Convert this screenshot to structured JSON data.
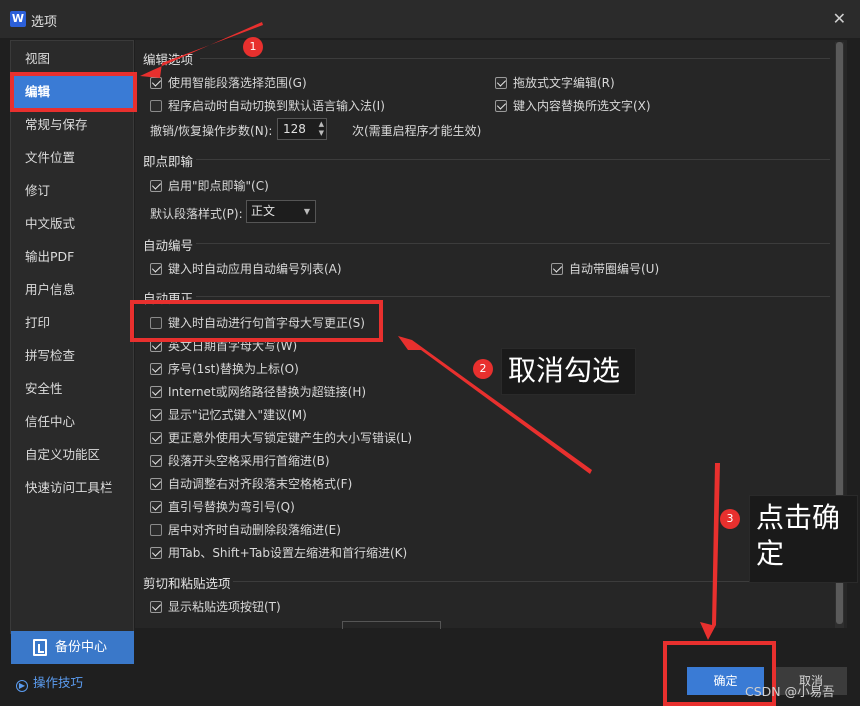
{
  "window": {
    "title": "选项",
    "logo_letter": "W"
  },
  "sidebar": {
    "items": [
      {
        "label": "视图"
      },
      {
        "label": "编辑"
      },
      {
        "label": "常规与保存"
      },
      {
        "label": "文件位置"
      },
      {
        "label": "修订"
      },
      {
        "label": "中文版式"
      },
      {
        "label": "输出PDF"
      },
      {
        "label": "用户信息"
      },
      {
        "label": "打印"
      },
      {
        "label": "拼写检查"
      },
      {
        "label": "安全性"
      },
      {
        "label": "信任中心"
      },
      {
        "label": "自定义功能区"
      },
      {
        "label": "快速访问工具栏"
      }
    ],
    "active_index": 1,
    "backup_label": "备份中心",
    "tips_label": "操作技巧"
  },
  "edit_options": {
    "title": "编辑选项",
    "smart_select": "使用智能段落选择范围(G)",
    "drag_edit": "拖放式文字编辑(R)",
    "auto_input_method": "程序启动时自动切换到默认语言输入法(I)",
    "replace_selection": "键入内容替换所选文字(X)",
    "undo_steps_label": "撤销/恢复操作步数(N):",
    "undo_steps_value": "128",
    "undo_steps_note": "次(需重启程序才能生效)"
  },
  "click_and_type": {
    "title": "即点即输",
    "enable": "启用\"即点即输\"(C)",
    "default_style_label": "默认段落样式(P):",
    "default_style_value": "正文"
  },
  "auto_numbering": {
    "title": "自动编号",
    "auto_list": "键入时自动应用自动编号列表(A)",
    "circle_number": "自动带圈编号(U)"
  },
  "autocorrect": {
    "title": "自动更正",
    "items": [
      {
        "label": "键入时自动进行句首字母大写更正(S)",
        "checked": false
      },
      {
        "label": "英文日期首字母大写(W)",
        "checked": true
      },
      {
        "label": "序号(1st)替换为上标(O)",
        "checked": true
      },
      {
        "label": "Internet或网络路径替换为超链接(H)",
        "checked": true
      },
      {
        "label": "显示\"记忆式键入\"建议(M)",
        "checked": true
      },
      {
        "label": "更正意外使用大写锁定键产生的大小写错误(L)",
        "checked": true
      },
      {
        "label": "段落开头空格采用行首缩进(B)",
        "checked": true
      },
      {
        "label": "自动调整右对齐段落末空格格式(F)",
        "checked": true
      },
      {
        "label": "直引号替换为弯引号(Q)",
        "checked": true
      },
      {
        "label": "居中对齐时自动删除段落缩进(E)",
        "checked": false
      },
      {
        "label": "用Tab、Shift+Tab设置左缩进和首行缩进(K)",
        "checked": true
      }
    ]
  },
  "cut_paste": {
    "title": "剪切和粘贴选项",
    "show_paste_button": "显示粘贴选项按钮(T)"
  },
  "annotations": {
    "badge1": "1",
    "badge2": "2",
    "badge3": "3",
    "callout2": "取消勾选",
    "callout3": "点击确定",
    "color": "#e8302e"
  },
  "buttons": {
    "ok": "确定",
    "cancel": "取消"
  },
  "watermark": "CSDN @小易吾"
}
